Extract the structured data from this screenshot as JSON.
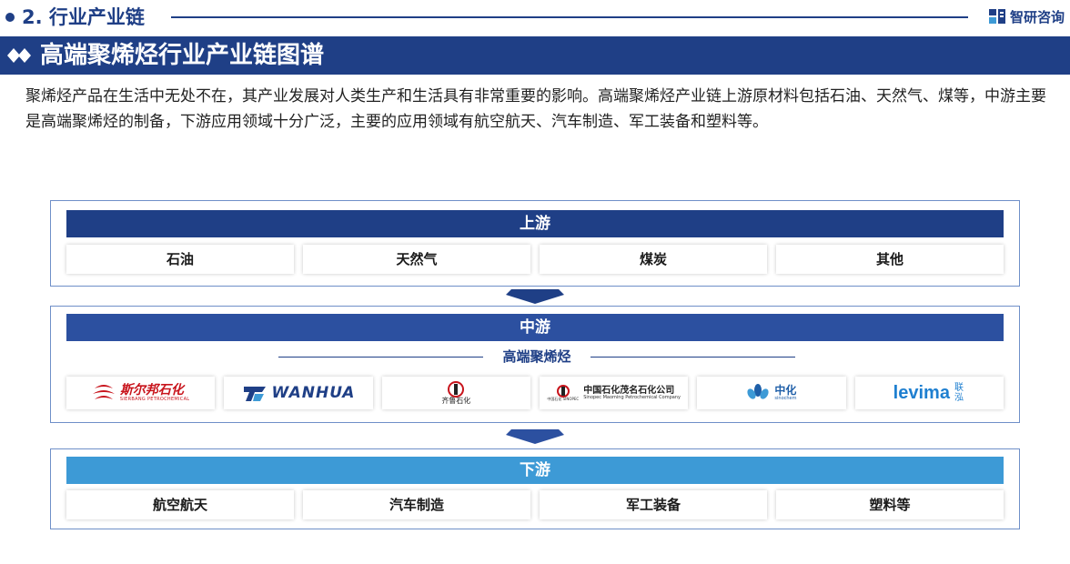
{
  "header": {
    "section_title": "2. 行业产业链",
    "brand": "智研咨询",
    "brand_color": "#1f3f86",
    "bullet_icon": "dot-icon"
  },
  "title_band": {
    "title": "高端聚烯烃行业产业链图谱",
    "icon": "double-diamond-icon"
  },
  "intro": "聚烯烃产品在生活中无处不在，其产业发展对人类生产和生活具有非常重要的影响。高端聚烯烃产业链上游原材料包括石油、天然气、煤等，中游主要是高端聚烯烃的制备，下游应用领域十分广泛，主要的应用领域有航空航天、汽车制造、军工装备和塑料等。",
  "upstream": {
    "title": "上游",
    "color": "#1f3f86",
    "items": [
      "石油",
      "天然气",
      "煤炭",
      "其他"
    ]
  },
  "midstream": {
    "title": "中游",
    "color": "#2c50a0",
    "subtitle": "高端聚烯烃",
    "companies": [
      {
        "name": "斯尔邦石化",
        "sub": "SIERBANG PETROCHEMICAL",
        "icon": "sierbang-logo-icon"
      },
      {
        "name": "WANHUA",
        "icon": "wanhua-logo-icon"
      },
      {
        "name": "齐鲁石化",
        "icon": "sinopec-logo-icon"
      },
      {
        "name": "中国石化茂名石化公司",
        "sub": "Sinopec Maoming Petrochemical Company",
        "left": "中国石化 SINOPEC",
        "icon": "sinopec-logo-icon"
      },
      {
        "name": "中化",
        "sub": "sinochem",
        "icon": "sinochem-logo-icon"
      },
      {
        "name": "levima",
        "cn": "联泓",
        "icon": "levima-logo-icon"
      }
    ]
  },
  "downstream": {
    "title": "下游",
    "color": "#3d9ad6",
    "items": [
      "航空航天",
      "汽车制造",
      "军工装备",
      "塑料等"
    ]
  },
  "arrow_icon": "down-arrow-icon"
}
